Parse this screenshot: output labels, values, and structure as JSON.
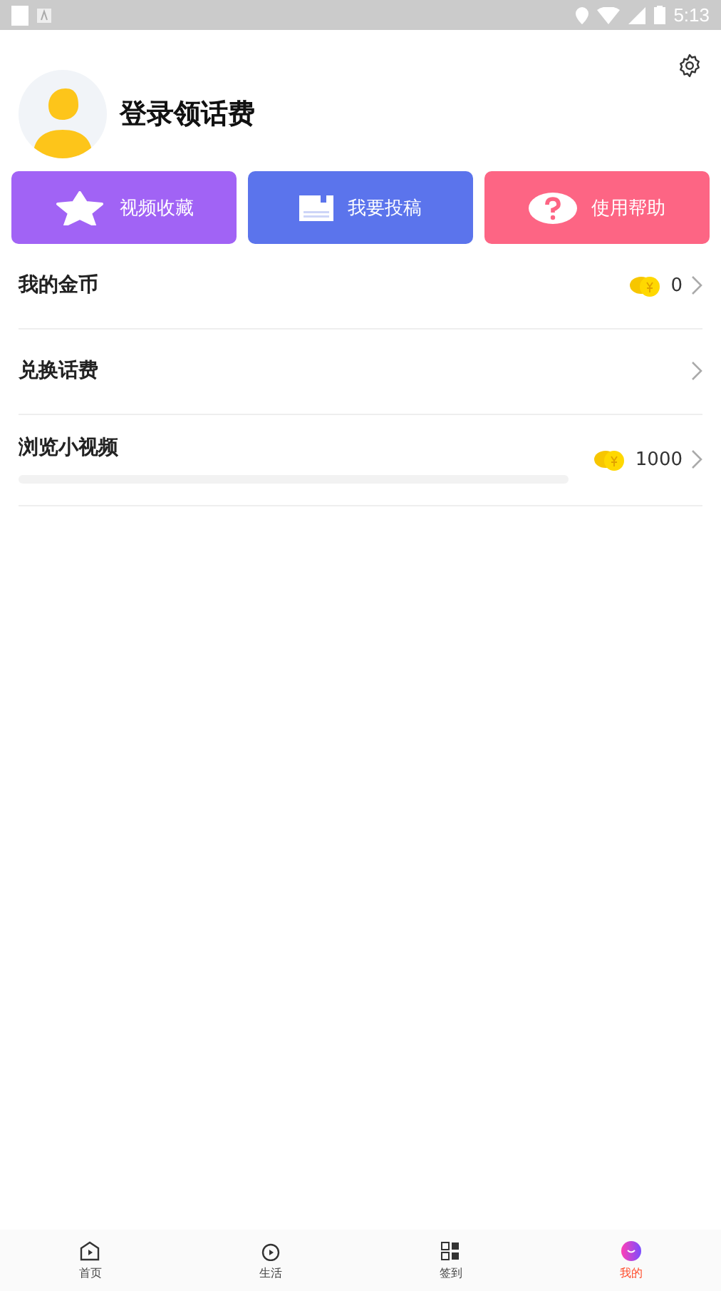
{
  "status_bar": {
    "time": "5:13"
  },
  "profile": {
    "name": "登录领话费"
  },
  "quick_actions": [
    {
      "label": "视频收藏",
      "kind": "star",
      "color": "#a163f5"
    },
    {
      "label": "我要投稿",
      "kind": "document",
      "color": "#5b74ec"
    },
    {
      "label": "使用帮助",
      "kind": "help",
      "color": "#fd6584"
    }
  ],
  "menu": [
    {
      "label": "我的金币",
      "value": "0",
      "kind": "plain"
    },
    {
      "label": "兑换话费",
      "kind": "plain"
    },
    {
      "label": "浏览小视频",
      "value": "1000",
      "kind": "progress"
    }
  ],
  "tabs": [
    {
      "label": "首页",
      "kind": "home",
      "selected": false
    },
    {
      "label": "生活",
      "kind": "play",
      "selected": false
    },
    {
      "label": "签到",
      "kind": "grid",
      "selected": false
    },
    {
      "label": "我的",
      "kind": "me",
      "selected": true
    }
  ]
}
